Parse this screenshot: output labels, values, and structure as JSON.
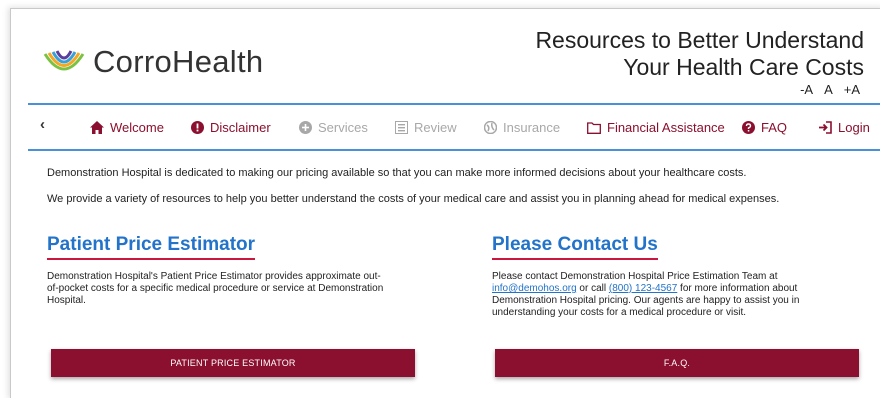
{
  "brand": {
    "name": "CorroHealth",
    "logo_icon": "concentric-swoosh-logo"
  },
  "header": {
    "tagline_line1": "Resources to Better Understand",
    "tagline_line2": "Your Health Care Costs",
    "font_small": "-A",
    "font_normal": "A",
    "font_large": "+A"
  },
  "nav": {
    "back_glyph": "‹",
    "items": [
      {
        "label": "Welcome",
        "icon": "home-icon",
        "state": "active"
      },
      {
        "label": "Disclaimer",
        "icon": "exclamation-circle-icon",
        "state": "active"
      },
      {
        "label": "Services",
        "icon": "plus-circle-icon",
        "state": "disabled"
      },
      {
        "label": "Review",
        "icon": "list-icon",
        "state": "disabled"
      },
      {
        "label": "Insurance",
        "icon": "globe-icon",
        "state": "disabled"
      },
      {
        "label": "Financial Assistance",
        "icon": "folder-icon",
        "state": "active"
      },
      {
        "label": "FAQ",
        "icon": "question-circle-icon",
        "state": "active"
      },
      {
        "label": "Login",
        "icon": "login-icon",
        "state": "active"
      }
    ]
  },
  "intro": {
    "line1": "Demonstration Hospital is dedicated to making our pricing available so that you can make more informed decisions about your healthcare costs.",
    "line2": "We provide a variety of resources to help you better understand the costs of your medical care and assist you in planning ahead for medical expenses."
  },
  "estimator": {
    "heading": "Patient Price Estimator",
    "text": "Demonstration Hospital's Patient Price Estimator provides approximate out-of-pocket costs for a specific medical procedure or service at Demonstration Hospital.",
    "button": "PATIENT PRICE ESTIMATOR"
  },
  "contact": {
    "heading": "Please Contact Us",
    "text_before": "Please contact Demonstration Hospital Price Estimation Team at ",
    "email": "info@demohos.org",
    "text_mid": " or call ",
    "phone": "(800) 123-4567",
    "text_after": " for more information about Demonstration Hospital pricing. Our agents are happy to assist you in understanding your costs for a medical procedure or visit.",
    "button": "F.A.Q."
  },
  "colors": {
    "accent": "#8b0f2e",
    "link": "#2273c9",
    "nav_border": "#4a90d9",
    "heading_underline": "#c9173d",
    "disabled": "#a8a8a8"
  }
}
